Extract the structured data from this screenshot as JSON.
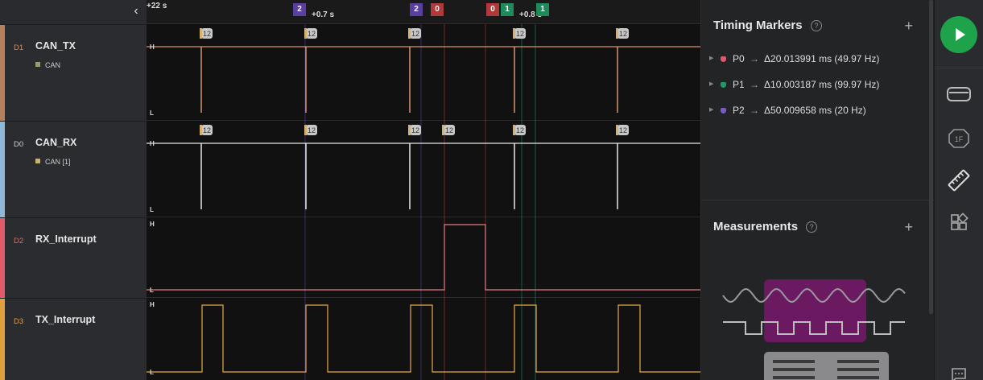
{
  "channels": [
    {
      "id": "D1",
      "name": "CAN_TX",
      "protocol": "CAN",
      "color": "#b5805a",
      "id_color": "#d78a61",
      "proto_color": "#9a9a6a"
    },
    {
      "id": "D0",
      "name": "CAN_RX",
      "protocol": "CAN [1]",
      "color": "#8fb6d6",
      "id_color": "#cfcfcf",
      "proto_color": "#c9b46a"
    },
    {
      "id": "D2",
      "name": "RX_Interrupt",
      "protocol": "",
      "color": "#e05a6a",
      "id_color": "#e26a6a",
      "proto_color": ""
    },
    {
      "id": "D3",
      "name": "TX_Interrupt",
      "protocol": "",
      "color": "#e0a040",
      "id_color": "#e0a040",
      "proto_color": ""
    }
  ],
  "timeline": {
    "labels": [
      {
        "text": "+22 s",
        "pos": "start"
      },
      {
        "text": "+0.7 s",
        "pos": "mid1"
      },
      {
        "text": "+0.8 s",
        "pos": "mid2"
      }
    ],
    "markers": [
      {
        "text": "2",
        "color": "#5b3fa0"
      },
      {
        "text": "2",
        "color": "#5b3fa0"
      },
      {
        "text": "0",
        "color": "#b03a3a"
      },
      {
        "text": "0",
        "color": "#b03a3a"
      },
      {
        "text": "1",
        "color": "#1f8a5a"
      },
      {
        "text": "1",
        "color": "#1f8a5a"
      }
    ]
  },
  "waves": {
    "level_high": "H",
    "level_low": "L",
    "frame_badge": "12",
    "colors": {
      "can_tx": "#d99470",
      "can_rx": "#e8e8e8",
      "rx_int": "#e87a80",
      "tx_int": "#e8aa48",
      "marker0": "#b03a3a",
      "marker1": "#1f8a5a",
      "marker2": "#5b3fa0"
    }
  },
  "timing_markers": {
    "title": "Timing Markers",
    "help": "?",
    "add": "+",
    "rows": [
      {
        "label": "P0",
        "arrow": "→",
        "value": "Δ20.013991 ms (49.97 Hz)",
        "color": "#e05a6a"
      },
      {
        "label": "P1",
        "arrow": "→",
        "value": "Δ10.003187 ms (99.97 Hz)",
        "color": "#1f9a6a"
      },
      {
        "label": "P2",
        "arrow": "→",
        "value": "Δ50.009658 ms (20 Hz)",
        "color": "#7a5ac8"
      }
    ]
  },
  "measurements": {
    "title": "Measurements",
    "help": "?",
    "add": "+"
  },
  "toolbar": {
    "collapse_icon": "‹",
    "icons": [
      "run-icon",
      "device-icon",
      "analyzer-icon",
      "ruler-icon",
      "extensions-icon",
      "chat-icon"
    ]
  }
}
